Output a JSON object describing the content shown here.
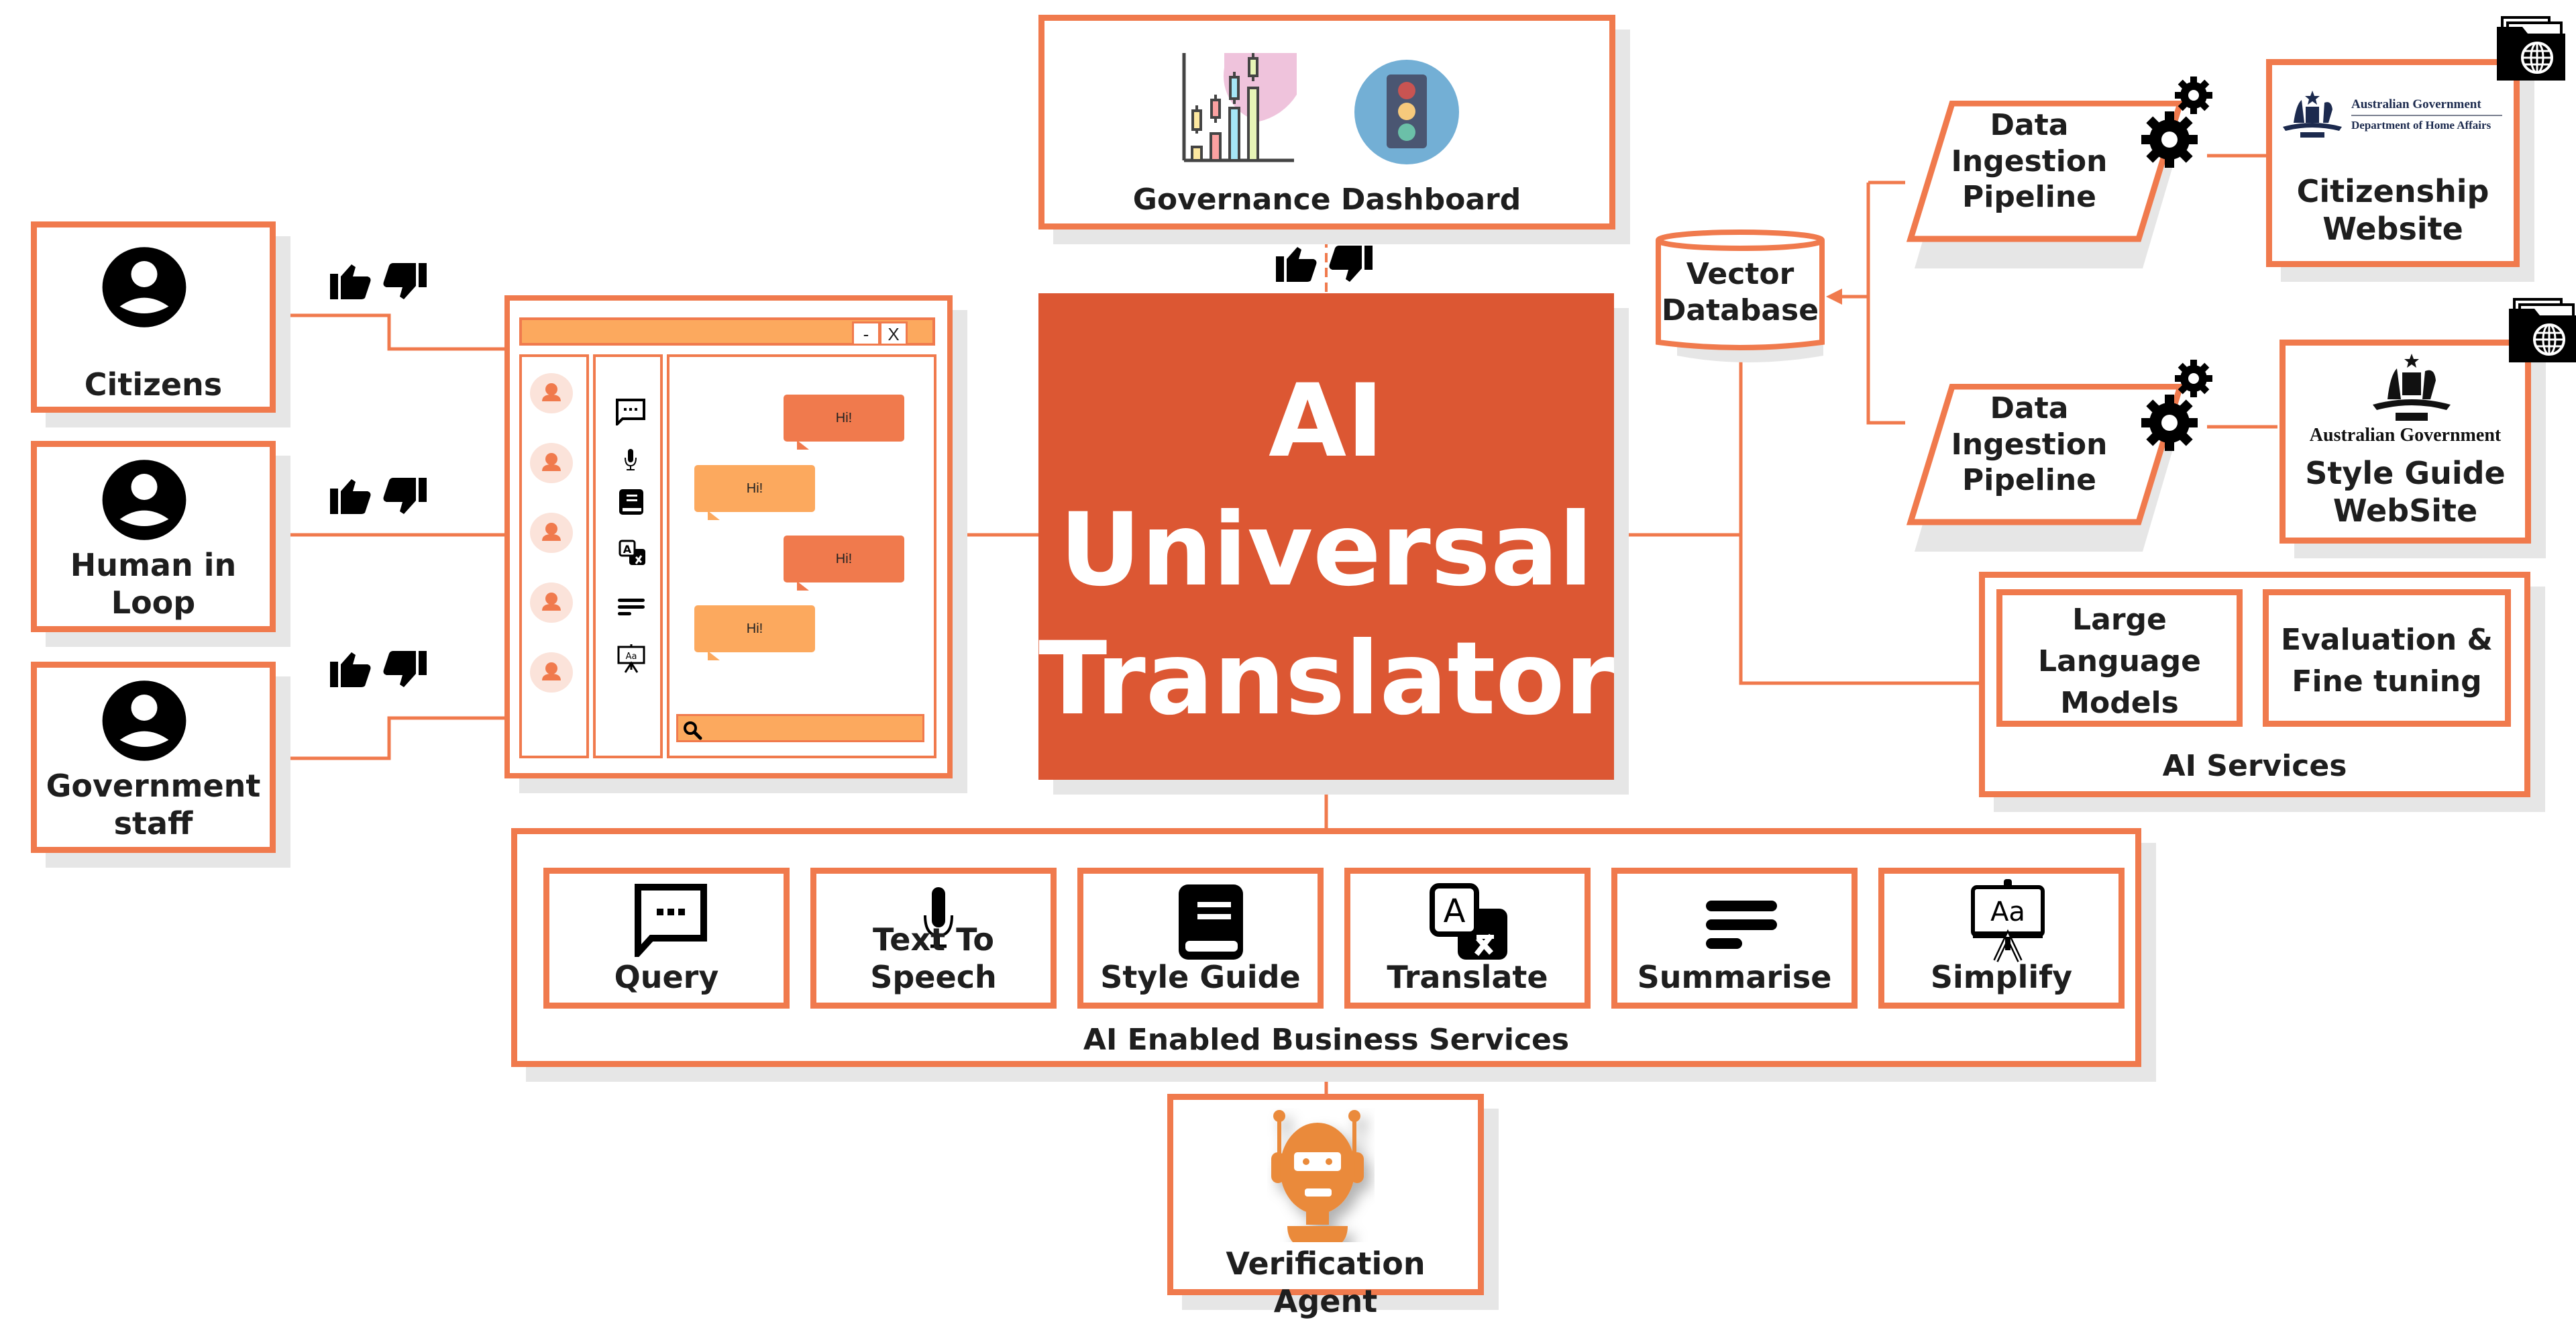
{
  "title": "AI Universal Translator",
  "colors": {
    "accent": "#f07a4d",
    "center": "#dc5733",
    "light_orange": "#fca95e",
    "shadow": "#e6e6e6",
    "text": "#1e1e1e"
  },
  "center": {
    "line1": "AI",
    "line2": "Universal",
    "line3": "Translator"
  },
  "users": [
    {
      "label_line1": "Citizens",
      "label_line2": "",
      "icon": "user-circle-icon"
    },
    {
      "label_line1": "Human in",
      "label_line2": "Loop",
      "icon": "user-circle-icon"
    },
    {
      "label_line1": "Government",
      "label_line2": "staff",
      "icon": "user-circle-icon"
    }
  ],
  "feedback_icons": [
    "thumbs-up-icon",
    "thumbs-down-icon"
  ],
  "chat_window": {
    "minimize_label": "-",
    "close_label": "X",
    "messages": [
      {
        "text": "Hi!",
        "side": "right"
      },
      {
        "text": "Hi!",
        "side": "left"
      },
      {
        "text": "Hi!",
        "side": "right"
      },
      {
        "text": "Hi!",
        "side": "left"
      }
    ],
    "tool_icons": [
      "chat-icon",
      "microphone-icon",
      "book-icon",
      "translate-icon",
      "summary-lines-icon",
      "easel-icon"
    ],
    "search_icon": "search-icon"
  },
  "governance": {
    "label": "Governance Dashboard",
    "icons": [
      "candlestick-chart-icon",
      "traffic-light-icon"
    ]
  },
  "vector_db": {
    "line1": "Vector",
    "line2": "Database"
  },
  "pipelines": [
    {
      "line1": "Data",
      "line2": "Ingestion",
      "line3": "Pipeline"
    },
    {
      "line1": "Data",
      "line2": "Ingestion",
      "line3": "Pipeline"
    }
  ],
  "sources": [
    {
      "logo_line1": "Australian Government",
      "logo_line2": "Department of Home Affairs",
      "label_line1": "Citizenship",
      "label_line2": "Website"
    },
    {
      "logo_line1": "Australian Government",
      "label_line1": "Style Guide",
      "label_line2": "WebSite"
    }
  ],
  "ai_services": {
    "label": "AI Services",
    "items": [
      {
        "line1": "Large",
        "line2": "Language",
        "line3": "Models"
      },
      {
        "line1": "Evaluation &",
        "line2": "Fine tuning"
      }
    ]
  },
  "business_services": {
    "label": "AI Enabled Business Services",
    "items": [
      {
        "label": "Query",
        "icon": "chat-icon"
      },
      {
        "label": "Text To Speech",
        "icon": "microphone-icon"
      },
      {
        "label": "Style Guide",
        "icon": "book-icon"
      },
      {
        "label": "Translate",
        "icon": "translate-icon"
      },
      {
        "label": "Summarise",
        "icon": "summary-lines-icon"
      },
      {
        "label": "Simplify",
        "icon": "easel-icon"
      }
    ]
  },
  "verification": {
    "label": "Verification Agent",
    "icon": "robot-icon"
  }
}
